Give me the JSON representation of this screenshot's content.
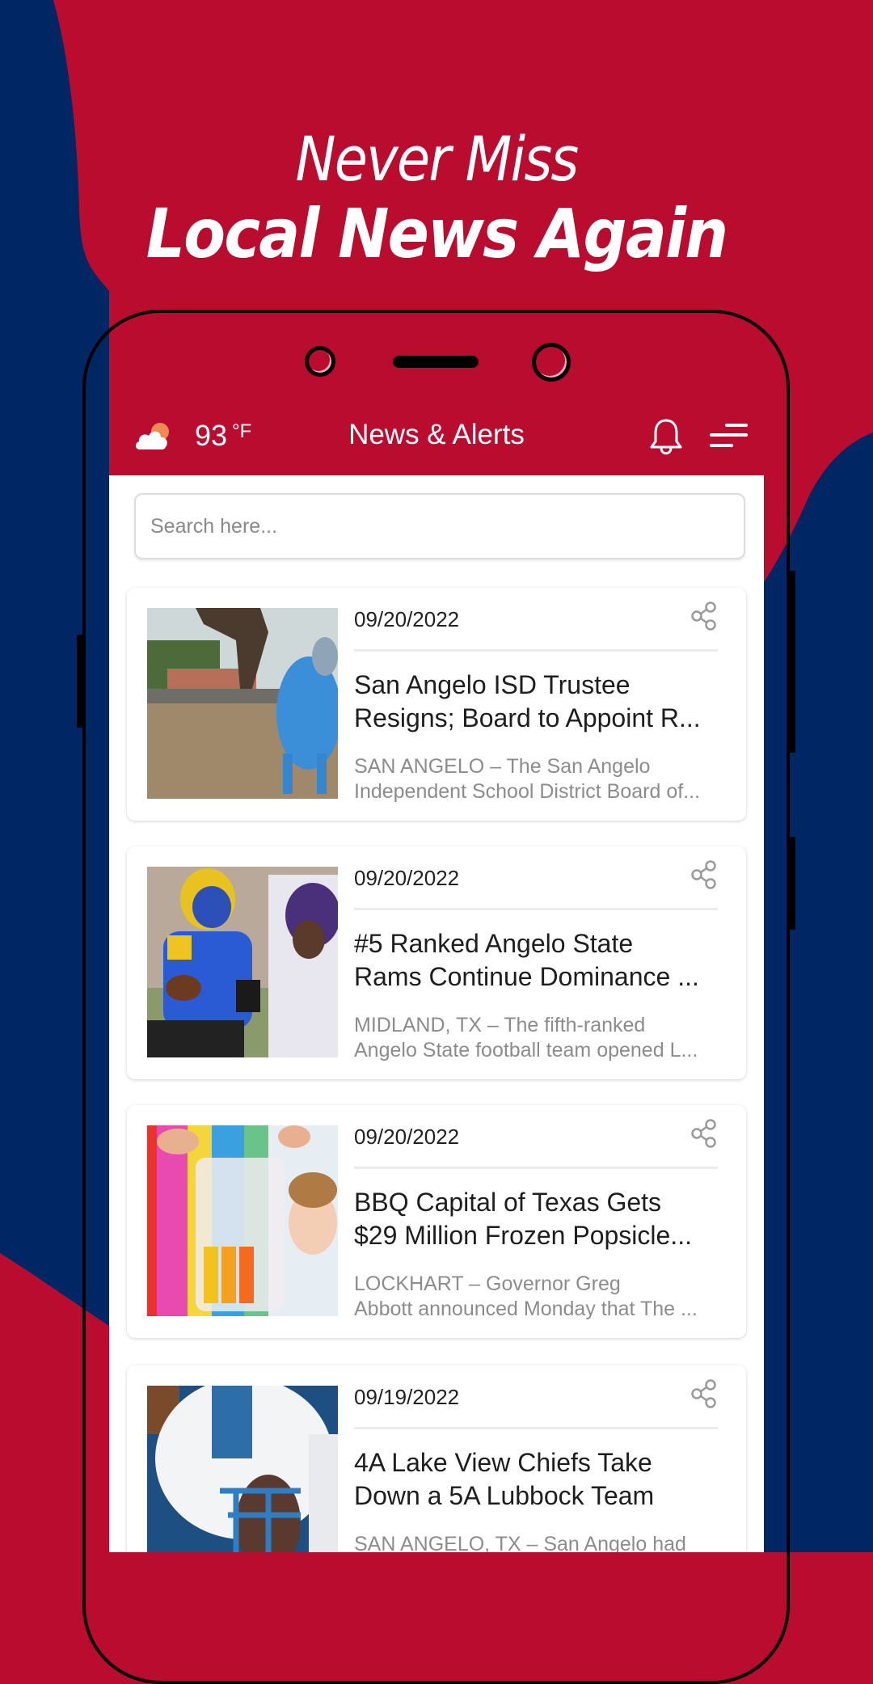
{
  "promo": {
    "headline_line1": "Never Miss",
    "headline_line2": "Local News Again"
  },
  "colors": {
    "brand_red": "#BA0C2F",
    "brand_blue": "#002664"
  },
  "app": {
    "header": {
      "weather_icon": "partly-cloudy-icon",
      "temperature": "93",
      "temperature_unit": "°F",
      "title": "News & Alerts",
      "notification_icon": "bell-icon",
      "menu_icon": "menu-icon"
    },
    "search": {
      "placeholder": "Search here...",
      "value": ""
    },
    "articles": [
      {
        "date": "09/20/2022",
        "title_line1": "San Angelo ISD Trustee",
        "title_line2": "Resigns; Board to Appoint R...",
        "summary_line1": "SAN ANGELO – The San Angelo",
        "summary_line2": "Independent School District Board of...",
        "image": "painted-ram-statue"
      },
      {
        "date": "09/20/2022",
        "title_line1": "#5 Ranked Angelo State",
        "title_line2": "Rams Continue Dominance ...",
        "summary_line1": "MIDLAND, TX – The fifth-ranked",
        "summary_line2": "Angelo State football team opened L...",
        "image": "football-players"
      },
      {
        "date": "09/20/2022",
        "title_line1": "BBQ Capital of Texas Gets",
        "title_line2": "$29 Million Frozen Popsicle...",
        "summary_line1": "LOCKHART – Governor Greg",
        "summary_line2": "Abbott announced Monday that The ...",
        "image": "popsicles-child"
      },
      {
        "date": "09/19/2022",
        "title_line1": "4A Lake View Chiefs Take",
        "title_line2": "Down a 5A Lubbock Team",
        "summary_line1": "SAN ANGELO, TX – San Angelo had",
        "summary_line2": "",
        "image": "football-helmet"
      }
    ]
  }
}
